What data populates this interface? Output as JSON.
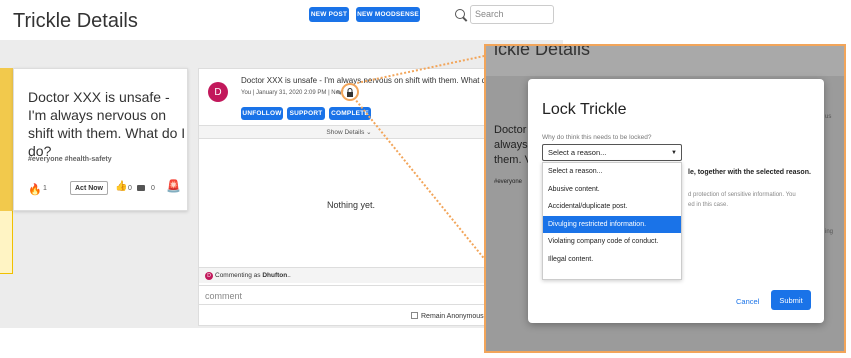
{
  "header": {
    "title": "Trickle Details",
    "new_post": "NEW POST",
    "new_moodsense": "NEW MOODSENSE",
    "search_placeholder": "Search"
  },
  "left_card": {
    "title": "Doctor XXX is unsafe - I'm always nervous on shift with them. What do I do?",
    "tags": "#everyone  #health-safety",
    "flame_count": "1",
    "act_now": "Act Now",
    "like_count": "0",
    "comment_count": "0"
  },
  "post": {
    "avatar": "D",
    "title": "Doctor XXX is unsafe - I'm always nervous on shift with them. What do I",
    "meta": "You | January 31, 2020 2:09 PM | New",
    "unfollow": "UNFOLLOW",
    "support": "SUPPORT",
    "complete": "COMPLETE",
    "show_details": "Show Details",
    "empty": "Nothing yet.",
    "commenting_prefix": "Commenting as",
    "commenting_user": "Dhufton",
    "comment_placeholder": "comment",
    "anonymous": "Remain Anonymous"
  },
  "modal": {
    "title": "Lock Trickle",
    "question": "Why do think this needs to be locked?",
    "selected": "Select a reason...",
    "options": [
      "Select a reason...",
      "Abusive content.",
      "Accidental/duplicate post.",
      "Divulging restricted information.",
      "Violating company code of conduct.",
      "Illegal content."
    ],
    "highlighted_index": 3,
    "peek_bold": "le, together with the selected reason.",
    "peek_gray1": "d protection of sensitive information. You",
    "peek_gray2": "ed in this case.",
    "cancel": "Cancel",
    "submit": "Submit",
    "bg_title_peek": "ickle Details",
    "peek_doctor": "Doctor",
    "peek_always": "always",
    "peek_them": "them. V",
    "peek_everyone": "#everyone",
    "peek_us": "us",
    "peek_ing": "ing"
  },
  "colors": {
    "accent": "#1a73e8",
    "highlight": "#f2a55a",
    "avatar": "#c2185b"
  }
}
